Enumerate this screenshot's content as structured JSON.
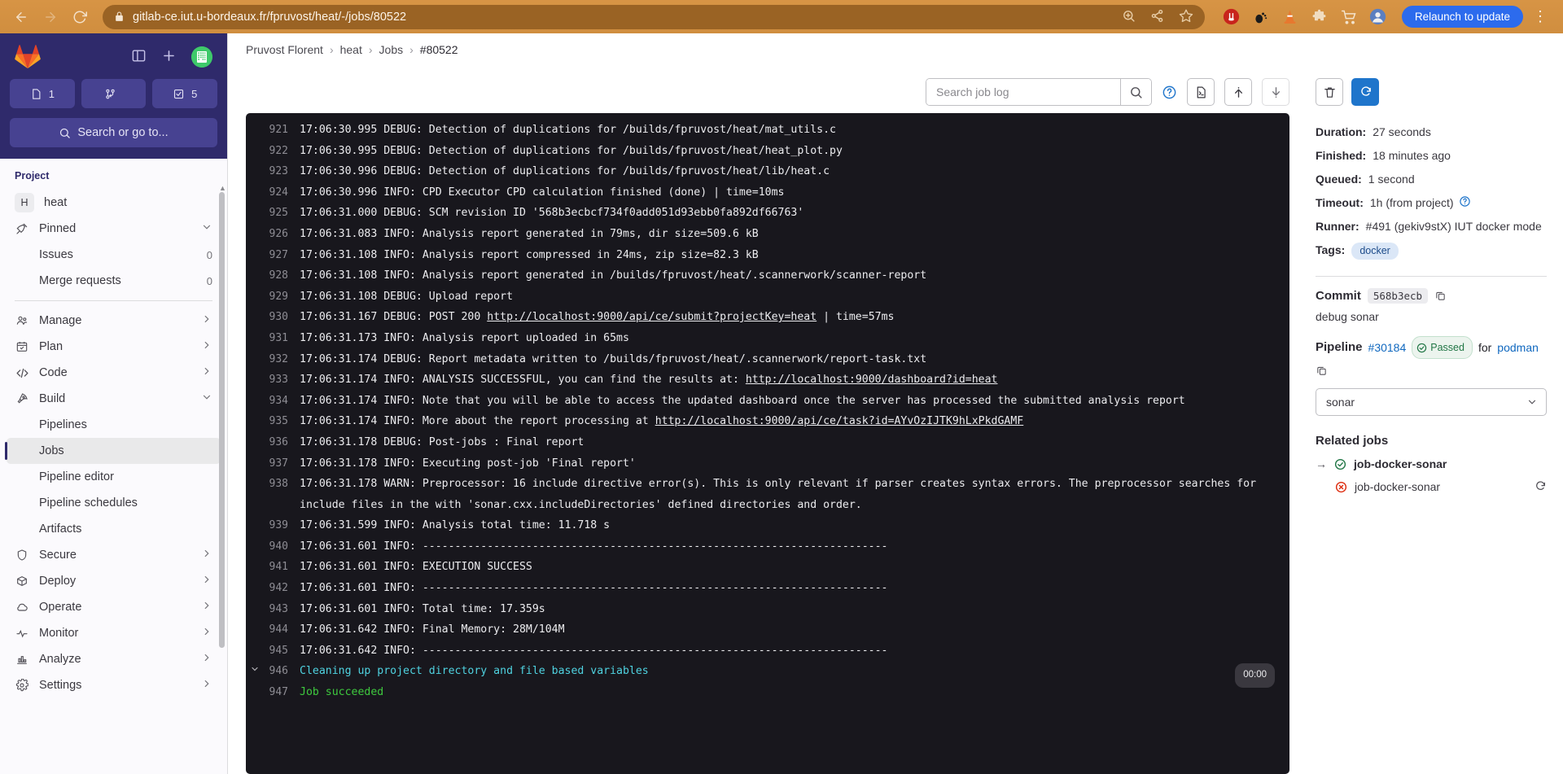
{
  "browser": {
    "url": "gitlab-ce.iut.u-bordeaux.fr/fpruvost/heat/-/jobs/80522",
    "relaunch_label": "Relaunch to update",
    "back_icon": "back-arrow-icon",
    "forward_icon": "forward-arrow-icon",
    "reload_icon": "reload-icon",
    "lock_icon": "lock-icon",
    "zoom_icon": "zoom-in-icon",
    "share_icon": "share-icon",
    "bookmark_icon": "bookmark-star-icon"
  },
  "sidebar": {
    "counters": [
      {
        "icon": "issues-icon",
        "value": "1"
      },
      {
        "icon": "merge-request-icon",
        "value": ""
      },
      {
        "icon": "todo-check-icon",
        "value": "5"
      }
    ],
    "search_placeholder": "Search or go to...",
    "section_title": "Project",
    "project": {
      "initial": "H",
      "name": "heat"
    },
    "items": [
      {
        "label": "Pinned",
        "icon": "pin-icon",
        "chevron": "chevron-down",
        "sub": false
      },
      {
        "label": "Issues",
        "icon": "",
        "badge": "0",
        "sub": true
      },
      {
        "label": "Merge requests",
        "icon": "",
        "badge": "0",
        "sub": true
      },
      {
        "label": "Manage",
        "icon": "users-icon",
        "chevron": "chevron-right",
        "sub": false
      },
      {
        "label": "Plan",
        "icon": "calendar-icon",
        "chevron": "chevron-right",
        "sub": false
      },
      {
        "label": "Code",
        "icon": "code-icon",
        "chevron": "chevron-right",
        "sub": false
      },
      {
        "label": "Build",
        "icon": "rocket-icon",
        "chevron": "chevron-down",
        "sub": false
      },
      {
        "label": "Pipelines",
        "icon": "",
        "sub": true
      },
      {
        "label": "Jobs",
        "icon": "",
        "sub": true,
        "active": true
      },
      {
        "label": "Pipeline editor",
        "icon": "",
        "sub": true
      },
      {
        "label": "Pipeline schedules",
        "icon": "",
        "sub": true
      },
      {
        "label": "Artifacts",
        "icon": "",
        "sub": true
      },
      {
        "label": "Secure",
        "icon": "shield-icon",
        "chevron": "chevron-right",
        "sub": false
      },
      {
        "label": "Deploy",
        "icon": "deploy-icon",
        "chevron": "chevron-right",
        "sub": false
      },
      {
        "label": "Operate",
        "icon": "cloud-icon",
        "chevron": "chevron-right",
        "sub": false
      },
      {
        "label": "Monitor",
        "icon": "monitor-icon",
        "chevron": "chevron-right",
        "sub": false
      },
      {
        "label": "Analyze",
        "icon": "chart-icon",
        "chevron": "chevron-right",
        "sub": false
      },
      {
        "label": "Settings",
        "icon": "gear-icon",
        "chevron": "chevron-right",
        "sub": false
      }
    ]
  },
  "breadcrumb": {
    "items": [
      "Pruvost Florent",
      "heat",
      "Jobs",
      "#80522"
    ]
  },
  "log_toolbar": {
    "search_placeholder": "Search job log",
    "search_value": "",
    "search_icon": "search-icon",
    "help_icon": "question-circle-icon",
    "raw_icon": "raw-log-file-icon",
    "scroll_top_icon": "scroll-to-top-icon",
    "scroll_bottom_icon": "scroll-to-bottom-icon"
  },
  "log": {
    "lines": [
      {
        "num": "921",
        "text": "17:06:30.995 DEBUG: Detection of duplications for /builds/fpruvost/heat/mat_utils.c"
      },
      {
        "num": "922",
        "text": "17:06:30.995 DEBUG: Detection of duplications for /builds/fpruvost/heat/heat_plot.py"
      },
      {
        "num": "923",
        "text": "17:06:30.996 DEBUG: Detection of duplications for /builds/fpruvost/heat/lib/heat.c"
      },
      {
        "num": "924",
        "text": "17:06:30.996 INFO: CPD Executor CPD calculation finished (done) | time=10ms"
      },
      {
        "num": "925",
        "text": "17:06:31.000 DEBUG: SCM revision ID '568b3ecbcf734f0add051d93ebb0fa892df66763'"
      },
      {
        "num": "926",
        "text": "17:06:31.083 INFO: Analysis report generated in 79ms, dir size=509.6 kB"
      },
      {
        "num": "927",
        "text": "17:06:31.108 INFO: Analysis report compressed in 24ms, zip size=82.3 kB"
      },
      {
        "num": "928",
        "text": "17:06:31.108 INFO: Analysis report generated in /builds/fpruvost/heat/.scannerwork/scanner-report"
      },
      {
        "num": "929",
        "text": "17:06:31.108 DEBUG: Upload report"
      },
      {
        "num": "930",
        "prefix": "17:06:31.167 DEBUG: POST 200 ",
        "link": "http://localhost:9000/api/ce/submit?projectKey=heat",
        "suffix": " | time=57ms"
      },
      {
        "num": "931",
        "text": "17:06:31.173 INFO: Analysis report uploaded in 65ms"
      },
      {
        "num": "932",
        "text": "17:06:31.174 DEBUG: Report metadata written to /builds/fpruvost/heat/.scannerwork/report-task.txt"
      },
      {
        "num": "933",
        "prefix": "17:06:31.174 INFO: ANALYSIS SUCCESSFUL, you can find the results at: ",
        "link": "http://localhost:9000/dashboard?id=heat",
        "suffix": ""
      },
      {
        "num": "934",
        "text": "17:06:31.174 INFO: Note that you will be able to access the updated dashboard once the server has processed the submitted analysis report"
      },
      {
        "num": "935",
        "prefix": "17:06:31.174 INFO: More about the report processing at ",
        "link": "http://localhost:9000/api/ce/task?id=AYvOzIJTK9hLxPkdGAMF",
        "suffix": ""
      },
      {
        "num": "936",
        "text": "17:06:31.178 DEBUG: Post-jobs : Final report"
      },
      {
        "num": "937",
        "text": "17:06:31.178 INFO: Executing post-job 'Final report'"
      },
      {
        "num": "938",
        "text": "17:06:31.178 WARN: Preprocessor: 16 include directive error(s). This is only relevant if parser creates syntax errors. The preprocessor searches for include files in the with 'sonar.cxx.includeDirectories' defined directories and order."
      },
      {
        "num": "939",
        "text": "17:06:31.599 INFO: Analysis total time: 11.718 s"
      },
      {
        "num": "940",
        "text": "17:06:31.601 INFO: ------------------------------------------------------------------------"
      },
      {
        "num": "941",
        "text": "17:06:31.601 INFO: EXECUTION SUCCESS"
      },
      {
        "num": "942",
        "text": "17:06:31.601 INFO: ------------------------------------------------------------------------"
      },
      {
        "num": "943",
        "text": "17:06:31.601 INFO: Total time: 17.359s"
      },
      {
        "num": "944",
        "text": "17:06:31.642 INFO: Final Memory: 28M/104M"
      },
      {
        "num": "945",
        "text": "17:06:31.642 INFO: ------------------------------------------------------------------------"
      },
      {
        "num": "946",
        "text": "Cleaning up project directory and file based variables",
        "color": "cyan",
        "chevron": "chevron-down",
        "time_badge": "00:00"
      },
      {
        "num": "947",
        "text": "Job succeeded",
        "color": "green"
      }
    ]
  },
  "details": {
    "erase_icon": "trash-icon",
    "retry_icon": "retry-icon",
    "rows": [
      {
        "key": "Duration:",
        "value": "27 seconds"
      },
      {
        "key": "Finished:",
        "value": "18 minutes ago"
      },
      {
        "key": "Queued:",
        "value": "1 second"
      },
      {
        "key": "Timeout:",
        "value": "1h (from project)",
        "help": true
      },
      {
        "key": "Runner:",
        "value": "#491 (gekiv9stX) IUT docker mode"
      },
      {
        "key": "Tags:",
        "tag": "docker"
      }
    ],
    "commit": {
      "label": "Commit",
      "sha": "568b3ecb",
      "copy_icon": "copy-icon",
      "message": "debug sonar"
    },
    "pipeline": {
      "label": "Pipeline",
      "id": "#30184",
      "status": "Passed",
      "status_icon": "check-circle-icon",
      "for_text": "for",
      "branch": "podman",
      "copy_icon": "copy-icon"
    },
    "stage_select": {
      "value": "sonar",
      "chevron_icon": "chevron-down-icon"
    },
    "related_jobs_title": "Related jobs",
    "related_jobs": [
      {
        "name": "job-docker-sonar",
        "icon": "check-circle-icon",
        "arrow": "→",
        "bold": true
      },
      {
        "name": "job-docker-sonar",
        "icon": "failed-circle-icon",
        "action_icon": "retry-icon",
        "bold": false
      }
    ]
  },
  "colors": {
    "accent": "#1f75cb",
    "sidebar_bg": "#2f2a6b",
    "log_bg": "#18171d",
    "success": "#3ec93e",
    "cyan": "#4fd2e0"
  }
}
